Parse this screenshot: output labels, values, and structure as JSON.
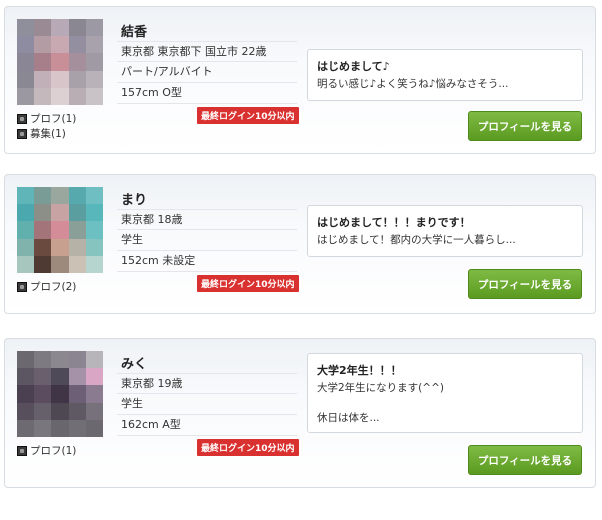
{
  "profiles": [
    {
      "name": "結香",
      "details": [
        "東京都 東京都下 国立市 22歳",
        "パート/アルバイト",
        "157cm O型"
      ],
      "login_badge": "最終ログイン10分以内",
      "links": [
        "プロフ(1)",
        "募集(1)"
      ],
      "message_title": "はじめまして♪",
      "message_body": "明るい感じ♪よく笑うね♪悩みなさそう...",
      "button_label": "プロフィールを見る",
      "avatar_colors": [
        "#8f8f9c",
        "#9a8a94",
        "#b7a9b5",
        "#8a8792",
        "#9c98a4",
        "#8e8ca0",
        "#b49ca4",
        "#c8a9b2",
        "#938ea0",
        "#a8a2ad",
        "#8b8696",
        "#a77f8b",
        "#c98f98",
        "#a58f9c",
        "#9f9aa4",
        "#8a8893",
        "#c2b0b8",
        "#d7c5c9",
        "#a9a1aa",
        "#b9b2b8",
        "#9c98a2",
        "#c5b8bd",
        "#ddd0d3",
        "#b9aeb4",
        "#c9c3c8"
      ]
    },
    {
      "name": "まり",
      "details": [
        "東京都 18歳",
        "学生",
        "152cm 未設定"
      ],
      "login_badge": "最終ログイン10分以内",
      "links": [
        "プロフ(2)"
      ],
      "message_title": "はじめまして！！！まりです！",
      "message_body": "はじめまして！都内の大学に一人暮らし...",
      "button_label": "プロフィールを見る",
      "avatar_colors": [
        "#5fb5b8",
        "#7a9c96",
        "#9aa79f",
        "#56a9ad",
        "#6fbfc2",
        "#4aa8ae",
        "#8c8f88",
        "#c7a3a3",
        "#5b9ea0",
        "#58b7bb",
        "#62b0ad",
        "#a3757a",
        "#d48c99",
        "#8a9f98",
        "#6cc0c1",
        "#7fb3ab",
        "#6a4a3f",
        "#c8a090",
        "#b7b2a8",
        "#86c4c0",
        "#a7c6be",
        "#4e3a33",
        "#9d8a7c",
        "#cbc1b4",
        "#b7d5cf"
      ]
    },
    {
      "name": "みく",
      "details": [
        "東京都 19歳",
        "学生",
        "162cm A型"
      ],
      "login_badge": "最終ログイン10分以内",
      "links": [
        "プロフ(1)"
      ],
      "message_title": "大学2年生！！！",
      "message_body": "大学2年生になります(^^)\n\n休日は体を...",
      "button_label": "プロフィールを見る",
      "avatar_colors": [
        "#6b6870",
        "#7d7a82",
        "#8c8890",
        "#8a8590",
        "#b7b4ba",
        "#5c5662",
        "#6a5f6c",
        "#4f4a58",
        "#a591a8",
        "#d9a6c6",
        "#4b3f52",
        "#5b4c60",
        "#3f3546",
        "#6d5f75",
        "#8a7b90",
        "#57505c",
        "#66606a",
        "#4e4852",
        "#5f5964",
        "#76717a",
        "#6e6a72",
        "#7a767e",
        "#6a666e",
        "#726e76",
        "#6c6870"
      ]
    }
  ]
}
